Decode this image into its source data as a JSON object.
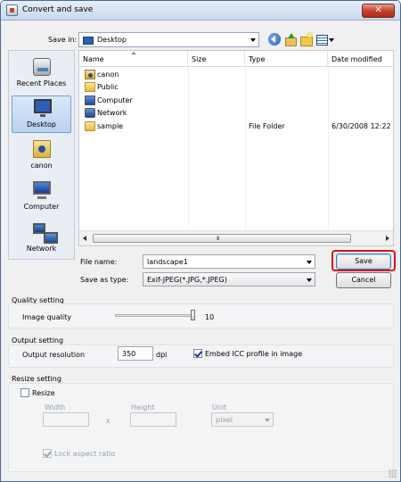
{
  "window": {
    "title": "Convert and save",
    "close_label": "✕"
  },
  "save_in": {
    "label": "Save in:",
    "value": "Desktop"
  },
  "places": [
    {
      "label": "Recent Places",
      "icon": "recent-places-icon"
    },
    {
      "label": "Desktop",
      "icon": "desktop-icon"
    },
    {
      "label": "canon",
      "icon": "user-folder-icon"
    },
    {
      "label": "Computer",
      "icon": "computer-icon"
    },
    {
      "label": "Network",
      "icon": "network-icon"
    }
  ],
  "file_list": {
    "columns": [
      "Name",
      "Size",
      "Type",
      "Date modified"
    ],
    "rows": [
      {
        "name": "canon",
        "type": "",
        "date": "",
        "icon": "user-folder-icon"
      },
      {
        "name": "Public",
        "type": "",
        "date": "",
        "icon": "folder-icon"
      },
      {
        "name": "Computer",
        "type": "",
        "date": "",
        "icon": "computer-icon"
      },
      {
        "name": "Network",
        "type": "",
        "date": "",
        "icon": "network-icon"
      },
      {
        "name": "sample",
        "type": "File Folder",
        "date": "6/30/2008 12:22",
        "icon": "folder-icon"
      }
    ],
    "scroll_grip": "III"
  },
  "file_name": {
    "label": "File name:",
    "value": "landscape1"
  },
  "save_as_type": {
    "label": "Save as type:",
    "value": "Exif-JPEG(*.JPG,*.JPEG)"
  },
  "buttons": {
    "save": "Save",
    "cancel": "Cancel"
  },
  "quality": {
    "section": "Quality setting",
    "label": "Image quality",
    "value": "10"
  },
  "output": {
    "section": "Output setting",
    "resolution_label": "Output resolution",
    "resolution_value": "350",
    "unit": "dpi",
    "embed_label": "Embed ICC profile in image",
    "embed_checked": true
  },
  "resize": {
    "section": "Resize setting",
    "resize_label": "Resize",
    "width_label": "Width",
    "height_label": "Height",
    "unit_label": "Unit",
    "x_sep": "x",
    "unit_value": "pixel",
    "lock_label": "Lock aspect ratio"
  },
  "colors": {
    "title_bar": "#c9d8ec",
    "close": "#c5442e",
    "highlight": "#e0101a",
    "selected": "#b9d2ef"
  }
}
